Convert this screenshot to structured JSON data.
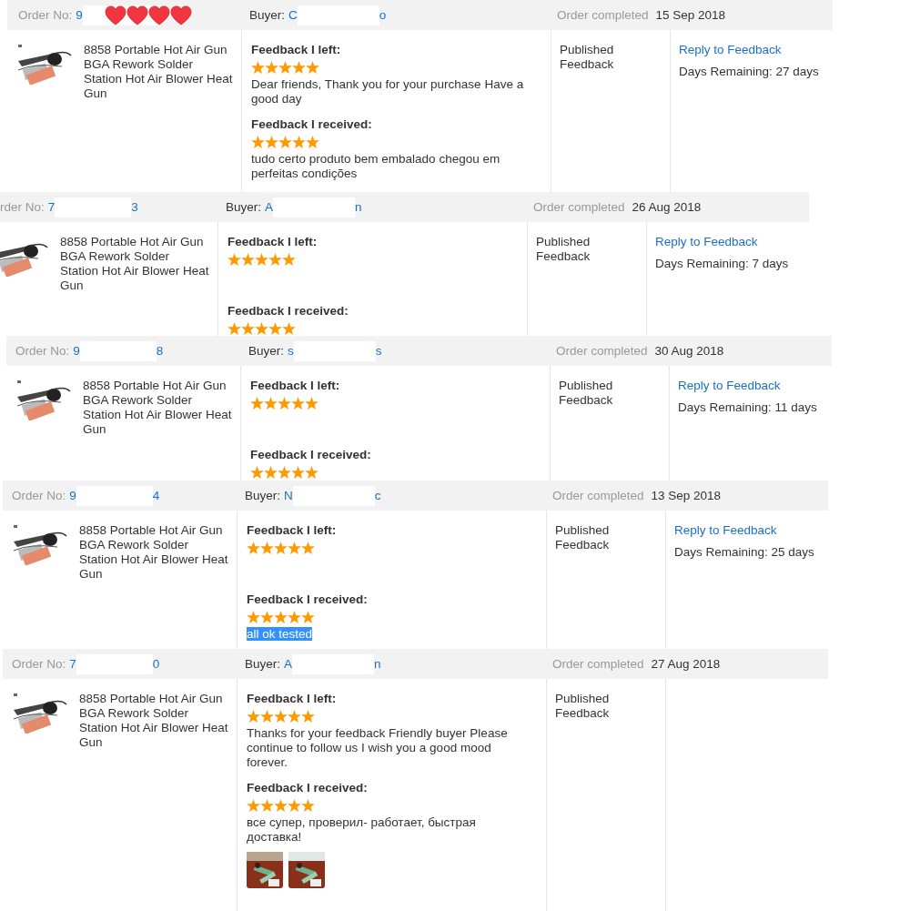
{
  "orders": [
    {
      "order_label": "Order No:",
      "order_start": "9",
      "hearts": true,
      "buyer_label": "Buyer:",
      "buyer_start": "C",
      "buyer_end": "o",
      "completed_label": "Order completed",
      "completed_date": "15 Sep 2018",
      "product": "8858 Portable Hot Air Gun BGA Rework Solder Station Hot Air Blower Heat Gun",
      "left": {
        "title": "Feedback I left:",
        "stars": 5,
        "comment": "Dear friends, Thank you for your purchase Have a good day"
      },
      "received": {
        "title": "Feedback I received:",
        "stars": 5,
        "comment": "tudo certo produto bem embalado chegou em perfeitas condições"
      },
      "status": "Published Feedback",
      "reply": "Reply to Feedback",
      "days": "Days Remaining: 27 days"
    },
    {
      "order_label": "rder No:",
      "order_start": "7",
      "order_end": "3",
      "buyer_label": "Buyer:",
      "buyer_start": "A",
      "buyer_end": "n",
      "completed_label": "Order completed",
      "completed_date": "26 Aug 2018",
      "product": "8858 Portable Hot Air Gun BGA Rework Solder Station Hot Air Blower Heat Gun",
      "left": {
        "title": "Feedback I left:",
        "stars": 5
      },
      "received": {
        "title": "Feedback I received:",
        "stars": 5
      },
      "status": "Published Feedback",
      "reply": "Reply to Feedback",
      "days": "Days Remaining: 7 days"
    },
    {
      "order_label": "Order No:",
      "order_start": "9",
      "order_end": "8",
      "buyer_label": "Buyer:",
      "buyer_start": "s",
      "buyer_end": "s",
      "completed_label": "Order completed",
      "completed_date": "30 Aug 2018",
      "product": "8858 Portable Hot Air Gun BGA Rework Solder Station Hot Air Blower Heat Gun",
      "left": {
        "title": "Feedback I left:",
        "stars": 5
      },
      "received": {
        "title": "Feedback I received:",
        "stars": 5
      },
      "status": "Published Feedback",
      "reply": "Reply to Feedback",
      "days": "Days Remaining: 11 days"
    },
    {
      "order_label": "Order No:",
      "order_start": "9",
      "order_end": "4",
      "buyer_label": "Buyer:",
      "buyer_start": "N",
      "buyer_end": "c",
      "completed_label": "Order completed",
      "completed_date": "13 Sep 2018",
      "product": "8858 Portable Hot Air Gun BGA Rework Solder Station Hot Air Blower Heat Gun",
      "left": {
        "title": "Feedback I left:",
        "stars": 5
      },
      "received": {
        "title": "Feedback I received:",
        "stars": 5,
        "comment": "all ok tested",
        "highlighted": true
      },
      "status": "Published Feedback",
      "reply": "Reply to Feedback",
      "days": "Days Remaining: 25 days"
    },
    {
      "order_label": "Order No:",
      "order_start": "7",
      "order_end": "0",
      "buyer_label": "Buyer:",
      "buyer_start": "A",
      "buyer_end": "n",
      "completed_label": "Order completed",
      "completed_date": "27 Aug 2018",
      "product": "8858 Portable Hot Air Gun BGA Rework Solder Station Hot Air Blower Heat Gun",
      "left": {
        "title": "Feedback I left:",
        "stars": 5,
        "comment": "Thanks for your feedback Friendly buyer Please continue to follow us I wish you a good mood forever."
      },
      "received": {
        "title": "Feedback I received:",
        "stars": 5,
        "comment": "все супер, проверил- работает, быстрая доставка!",
        "photos": [
          {
            "kind": "picture"
          },
          {
            "kind": "picture"
          }
        ]
      },
      "status": "Published Feedback"
    }
  ]
}
